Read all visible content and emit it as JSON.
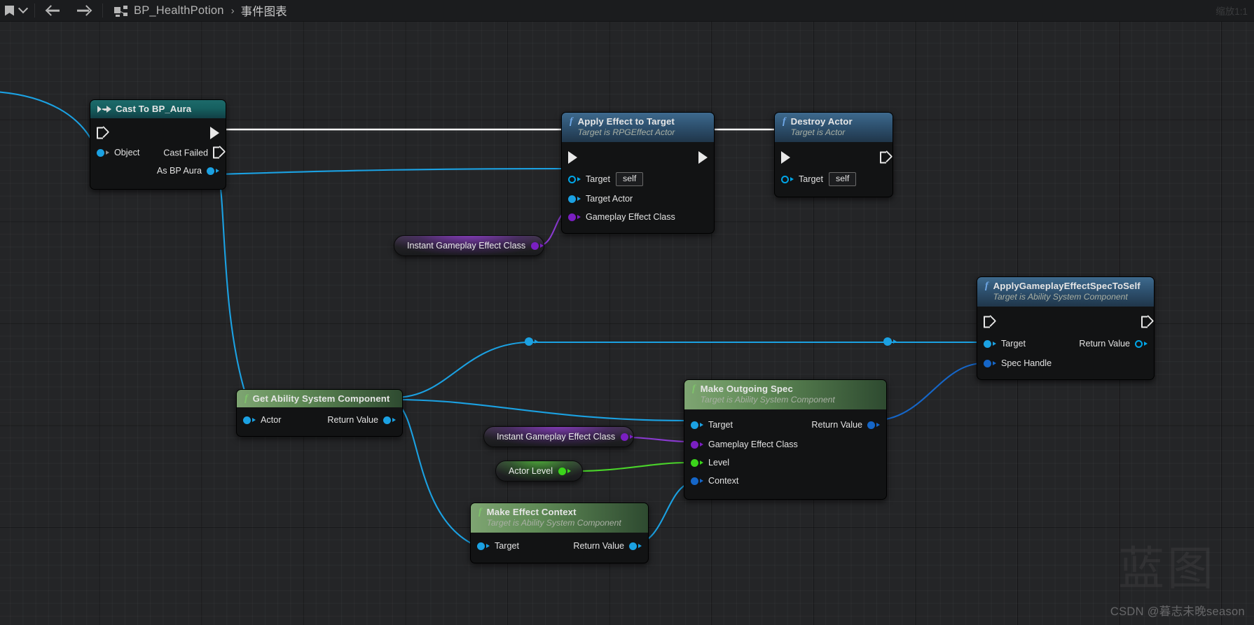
{
  "toolbar": {
    "bookmark_icon": "bookmark-icon",
    "dropdown_icon": "chevron-down-icon",
    "back_icon": "arrow-left-icon",
    "forward_icon": "arrow-right-icon",
    "graph_icon": "blueprint-graph-icon",
    "blueprint_name": "BP_HealthPotion",
    "breadcrumb_separator": "›",
    "graph_name": "事件图表",
    "zoom_label": "缩放1:1"
  },
  "nodes": {
    "cast_to_bp_aura": {
      "title": "Cast To BP_Aura",
      "exec_in": "",
      "exec_out": "",
      "input_pin": "Object",
      "output_pin_1": "Cast Failed",
      "output_pin_2": "As BP Aura"
    },
    "apply_effect_to_target": {
      "title": "Apply Effect to Target",
      "subtitle": "Target is RPGEffect Actor",
      "pins": [
        "Target",
        "Target Actor",
        "Gameplay Effect Class"
      ],
      "target_value": "self"
    },
    "destroy_actor": {
      "title": "Destroy Actor",
      "subtitle": "Target is Actor",
      "pins": [
        "Target"
      ],
      "target_value": "self"
    },
    "instant_gameplay_effect_class_1": {
      "label": "Instant Gameplay Effect Class"
    },
    "apply_gameplay_effect_spec_to_self": {
      "title": "ApplyGameplayEffectSpecToSelf",
      "subtitle": "Target is Ability System Component",
      "inputs": [
        "Target",
        "Spec Handle"
      ],
      "outputs": [
        "Return Value"
      ]
    },
    "get_ability_system_component": {
      "title": "Get Ability System Component",
      "inputs": [
        "Actor"
      ],
      "outputs": [
        "Return Value"
      ]
    },
    "make_outgoing_spec": {
      "title": "Make Outgoing Spec",
      "subtitle": "Target is Ability System Component",
      "inputs": [
        "Target",
        "Gameplay Effect Class",
        "Level",
        "Context"
      ],
      "outputs": [
        "Return Value"
      ]
    },
    "instant_gameplay_effect_class_2": {
      "label": "Instant Gameplay Effect Class"
    },
    "actor_level": {
      "label": "Actor Level"
    },
    "make_effect_context": {
      "title": "Make Effect Context",
      "subtitle": "Target is Ability System Component",
      "inputs": [
        "Target"
      ],
      "outputs": [
        "Return Value"
      ]
    }
  },
  "watermark": {
    "logo": "蓝图",
    "credit": "CSDN @暮志未晚season"
  },
  "colors": {
    "exec_wire": "#ffffff",
    "object_wire": "#1ba1e2",
    "class_wire": "#8a3ad1",
    "int_wire": "#4ad42a",
    "pin_blue": "#1ba1e2",
    "pin_darkblue": "#1566c8",
    "pin_purple": "#7a1fc2",
    "pin_green": "#3bd41b",
    "node_bg": "#121314"
  }
}
